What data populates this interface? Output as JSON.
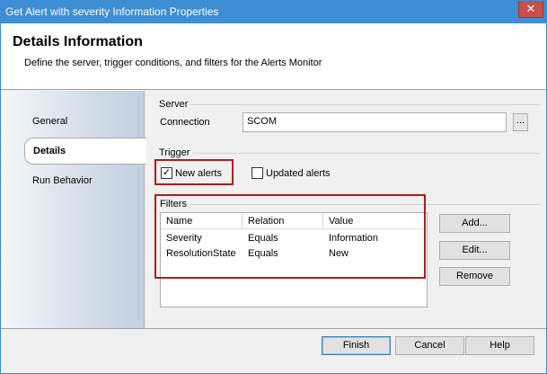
{
  "window": {
    "title": "Get Alert with severity Information Properties",
    "close_glyph": "✕"
  },
  "header": {
    "title": "Details Information",
    "subtitle": "Define the server, trigger conditions, and filters for the Alerts Monitor"
  },
  "nav": {
    "items": [
      "General",
      "Details",
      "Run Behavior"
    ],
    "active": "Details"
  },
  "server": {
    "group_label": "Server",
    "connection_label": "Connection",
    "connection_value": "SCOM",
    "browse_label": "..."
  },
  "trigger": {
    "group_label": "Trigger",
    "new_alerts": {
      "label": "New alerts",
      "checked": true,
      "check_glyph": "✓"
    },
    "updated_alerts": {
      "label": "Updated alerts",
      "checked": false
    }
  },
  "filters": {
    "group_label": "Filters",
    "columns": [
      "Name",
      "Relation",
      "Value"
    ],
    "rows": [
      [
        "Severity",
        "Equals",
        "Information"
      ],
      [
        "ResolutionState",
        "Equals",
        "New"
      ]
    ],
    "add_label": "Add...",
    "edit_label": "Edit...",
    "remove_label": "Remove"
  },
  "footer": {
    "finish_label": "Finish",
    "cancel_label": "Cancel",
    "help_label": "Help"
  },
  "colors": {
    "titlebar": "#3d8ed4",
    "highlight_box": "#b01c1c",
    "close_button": "#c7504a"
  }
}
